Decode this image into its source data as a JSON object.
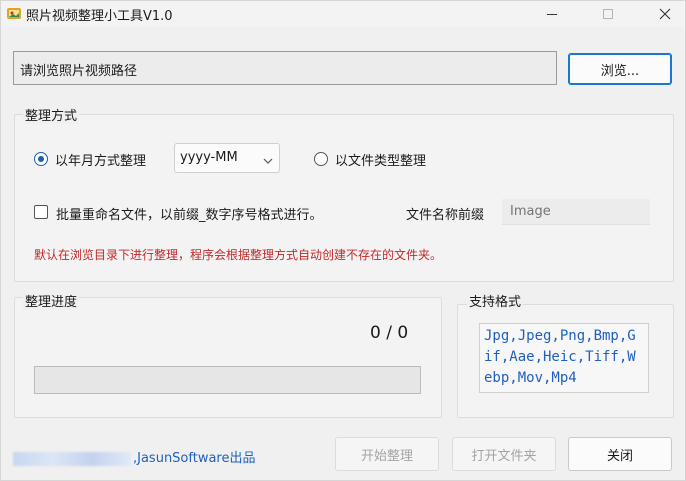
{
  "window": {
    "title": "照片视频整理小工具V1.0"
  },
  "path": {
    "placeholder_text": "请浏览照片视频路径",
    "browse_label": "浏览..."
  },
  "mode": {
    "legend": "整理方式",
    "by_year_label": "以年月方式整理",
    "date_format": "yyyy-MM",
    "by_type_label": "以文件类型整理",
    "rename_label": "批量重命名文件，以前缀_数字序号格式进行。",
    "prefix_label": "文件名称前缀",
    "prefix_placeholder": "Image",
    "note": "默认在浏览目录下进行整理，程序会根据整理方式自动创建不存在的文件夹。",
    "by_year_checked": true,
    "by_type_checked": false,
    "rename_checked": false
  },
  "progress": {
    "legend": "整理进度",
    "count_text": "0 / 0",
    "fraction": 0
  },
  "formats": {
    "legend": "支持格式",
    "text": "Jpg,Jpeg,Png,Bmp,Gif,Aae,Heic,Tiff,Webp,Mov,Mp4"
  },
  "footer": {
    "credit": ",JasunSoftware出品",
    "start_label": "开始整理",
    "open_folder_label": "打开文件夹",
    "close_label": "关闭"
  },
  "colors": {
    "accent": "#1976d2",
    "note_red": "#c62828",
    "link_blue": "#1f5fbf"
  }
}
